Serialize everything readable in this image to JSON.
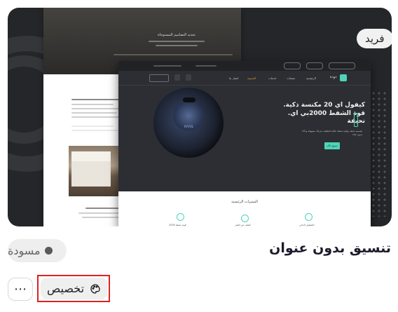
{
  "preview": {
    "badge": "فريد",
    "back_page": {
      "hero_title": "تجديد التصاميم المستوحاة"
    },
    "front_page": {
      "logo_text": "دودة",
      "nav_items": [
        "الرئيسية",
        "منتجات",
        "خدمات",
        "المدونة",
        "اتصل بنا"
      ],
      "hero_title": "كيفول اي 20 مكنسة ذكية. قوة الشفط 2000بي اي. نحيفة",
      "hero_desc": "تصميم نحيف وقوة شفط عالية لتنظيف منزلك بسهولة وذكاء بدون عناء",
      "hero_cta": "تسوق الآن",
      "robot_label": "KYVOL",
      "features_title": "المميزات الرئيسية",
      "features": [
        "التشغيل الذاتي",
        "كشف عن الغبار",
        "قوة شفط 2000"
      ]
    }
  },
  "card": {
    "title": "تنسيق بدون عنوان",
    "status": "مسودة",
    "customize_label": "تخصيص",
    "more_label": "⋯"
  },
  "colors": {
    "accent": "#4fd4b7",
    "highlight": "#e02020",
    "status_dot": "#5a5a5a"
  }
}
